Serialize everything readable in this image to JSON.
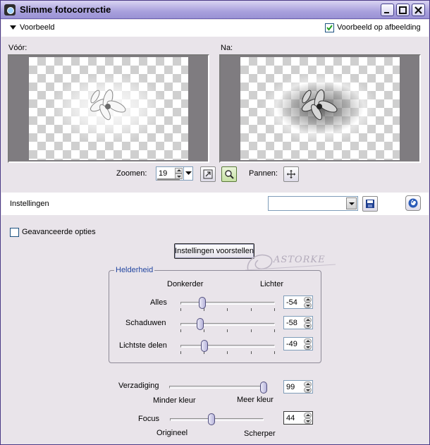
{
  "window": {
    "title": "Slimme fotocorrectie",
    "icon": "camera-icon"
  },
  "preview": {
    "section_label": "Voorbeeld",
    "show_on_image_label": "Voorbeeld op afbeelding",
    "show_on_image_checked": true,
    "before_label": "Vóór:",
    "after_label": "Na:"
  },
  "zoom": {
    "label": "Zoomen:",
    "value": "19",
    "pan_label": "Pannen:"
  },
  "settings": {
    "label": "Instellingen",
    "selected": ""
  },
  "advanced": {
    "label": "Geavanceerde opties",
    "checked": false
  },
  "suggest_button": "Instellingen voorstellen",
  "watermark": "ASTORKE",
  "brightness": {
    "group_title": "Helderheid",
    "darker_label": "Donkerder",
    "lighter_label": "Lichter",
    "sliders": [
      {
        "label": "Alles",
        "value": "-54",
        "range": [
          -100,
          100
        ]
      },
      {
        "label": "Schaduwen",
        "value": "-58",
        "range": [
          -100,
          100
        ]
      },
      {
        "label": "Lichtste delen",
        "value": "-49",
        "range": [
          -100,
          100
        ]
      }
    ]
  },
  "saturation": {
    "label": "Verzadiging",
    "value": "99",
    "range": [
      0,
      100
    ],
    "min_label": "Minder kleur",
    "max_label": "Meer kleur"
  },
  "focus": {
    "label": "Focus",
    "value": "44",
    "range": [
      0,
      100
    ],
    "min_label": "Origineel",
    "max_label": "Scherper"
  }
}
